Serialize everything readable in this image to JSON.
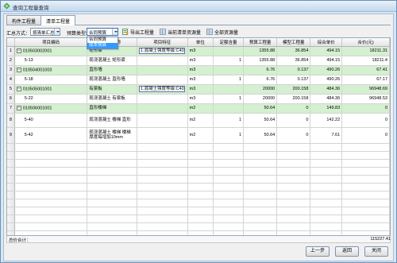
{
  "window": {
    "title": "查询工程量查询"
  },
  "tabs": [
    {
      "label": "构件工程量",
      "active": false
    },
    {
      "label": "清单工程量",
      "active": true
    }
  ],
  "toolbar": {
    "summary_label": "汇总方式：",
    "summary_value": "按清单汇总",
    "budget_label": "预算类型:",
    "budget_value": "合同预算",
    "export_label": "导出工程量",
    "current_resource_label": "当前清单资源量",
    "all_resource_label": "全部资源量"
  },
  "dropdown": {
    "options": [
      "合同预算",
      "成本预算"
    ],
    "selected_index": 1
  },
  "grid": {
    "columns": [
      "项目编码",
      "项目名称",
      "项目特征",
      "单位",
      "定额含量",
      "预算工程量",
      "模型工程量",
      "综合单价",
      "合价(元)"
    ],
    "rows": [
      {
        "rh": "1",
        "expander": "−",
        "code": "010503002001",
        "name": "矩形梁",
        "feature": "1.混凝土强度等级:C40",
        "unit": "m3",
        "ratio": "",
        "budget_qty": "1355.88",
        "model_qty": "36.854",
        "unit_price": "494.15",
        "total": "18211.31",
        "style": "green"
      },
      {
        "rh": "2",
        "expander": "",
        "code": "5-13",
        "name": "现浇混凝土 矩形梁",
        "feature": "",
        "unit": "m3",
        "ratio": "1",
        "budget_qty": "1355.88",
        "model_qty": "36.854",
        "unit_price": "494.15",
        "total": "18211.4",
        "style": ""
      },
      {
        "rh": "3",
        "expander": "−",
        "code": "010504001003",
        "name": "直形墙",
        "feature": "",
        "unit": "m3",
        "ratio": "",
        "budget_qty": "6.76",
        "model_qty": "0.137",
        "unit_price": "490.26",
        "total": "67.41",
        "style": "green"
      },
      {
        "rh": "4",
        "expander": "",
        "code": "5-18",
        "name": "现浇混凝土 直形墙",
        "feature": "",
        "unit": "m3",
        "ratio": "1",
        "budget_qty": "6.76",
        "model_qty": "0.137",
        "unit_price": "490.26",
        "total": "67.17",
        "style": ""
      },
      {
        "rh": "5",
        "expander": "−",
        "code": "010505001001",
        "name": "有梁板",
        "feature": "1.混凝土强度等级:C40",
        "unit": "m3",
        "ratio": "",
        "budget_qty": "20000",
        "model_qty": "200.158",
        "unit_price": "484.36",
        "total": "96948.69",
        "style": "green"
      },
      {
        "rh": "6",
        "expander": "",
        "code": "5-22",
        "name": "现浇混凝土 有梁板",
        "feature": "",
        "unit": "m3",
        "ratio": "1",
        "budget_qty": "20000",
        "model_qty": "200.158",
        "unit_price": "484.36",
        "total": "96948.53",
        "style": ""
      },
      {
        "rh": "7",
        "expander": "−",
        "code": "010506001001",
        "name": "直形楼梯",
        "feature": "",
        "unit": "m2",
        "ratio": "",
        "budget_qty": "50.64",
        "model_qty": "0",
        "unit_price": "149.83",
        "total": "0",
        "style": "green"
      },
      {
        "rh": "8",
        "expander": "",
        "code": "5-40",
        "name": "现浇混凝土 楼梯 直形",
        "feature": "",
        "unit": "m2",
        "ratio": "1",
        "budget_qty": "50.64",
        "model_qty": "0",
        "unit_price": "142.22",
        "total": "0",
        "style": ""
      },
      {
        "rh": "9",
        "expander": "",
        "code": "5-42",
        "name": "现浇混凝土 楼梯 楼梯厚度每增加10mm",
        "feature": "",
        "unit": "m2",
        "ratio": "1",
        "budget_qty": "50.64",
        "model_qty": "0",
        "unit_price": "7.61",
        "total": "0",
        "style": ""
      }
    ],
    "footer_label": "总价合计：",
    "footer_total": "115227.41"
  },
  "buttons": {
    "prev": "上一步",
    "back": "返回",
    "close": "关闭"
  },
  "colors": {
    "window_frame": "#d6e6f5",
    "bill_row_green": "#d5efd1",
    "dropdown_highlight": "#3399ff"
  }
}
